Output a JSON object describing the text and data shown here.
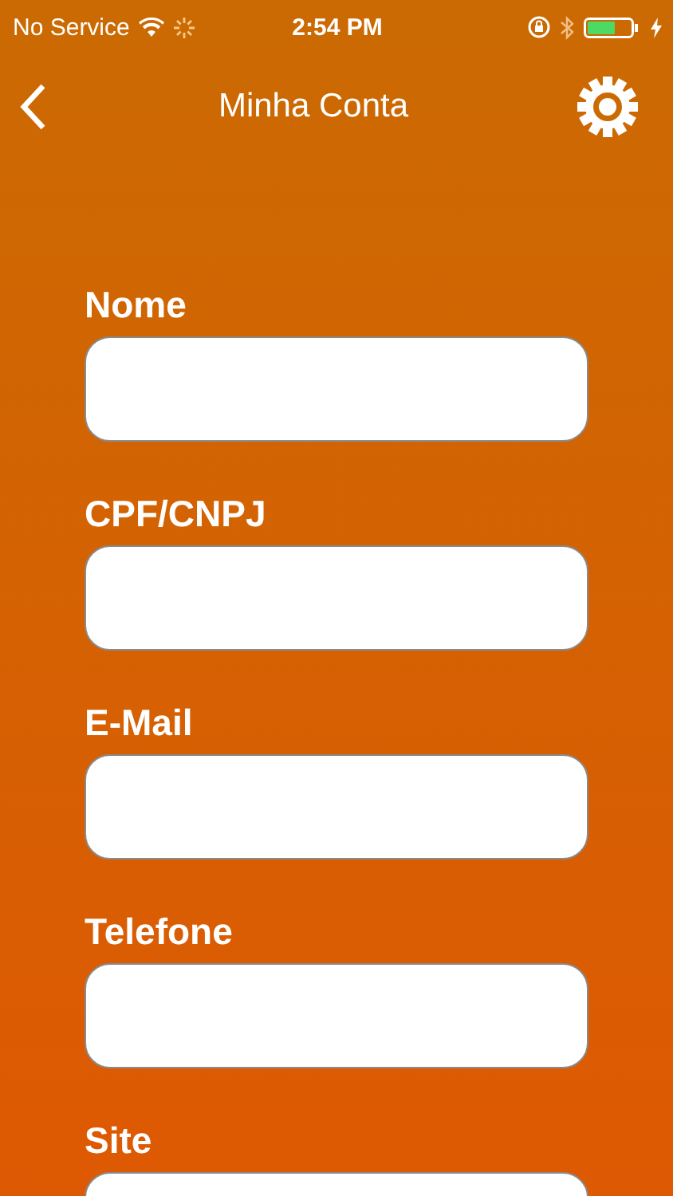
{
  "status_bar": {
    "carrier": "No Service",
    "time": "2:54 PM"
  },
  "nav_bar": {
    "title": "Minha Conta"
  },
  "fields": [
    {
      "label": "Nome"
    },
    {
      "label": "CPF/CNPJ"
    },
    {
      "label": "E-Mail"
    },
    {
      "label": "Telefone"
    },
    {
      "label": "Site"
    }
  ]
}
